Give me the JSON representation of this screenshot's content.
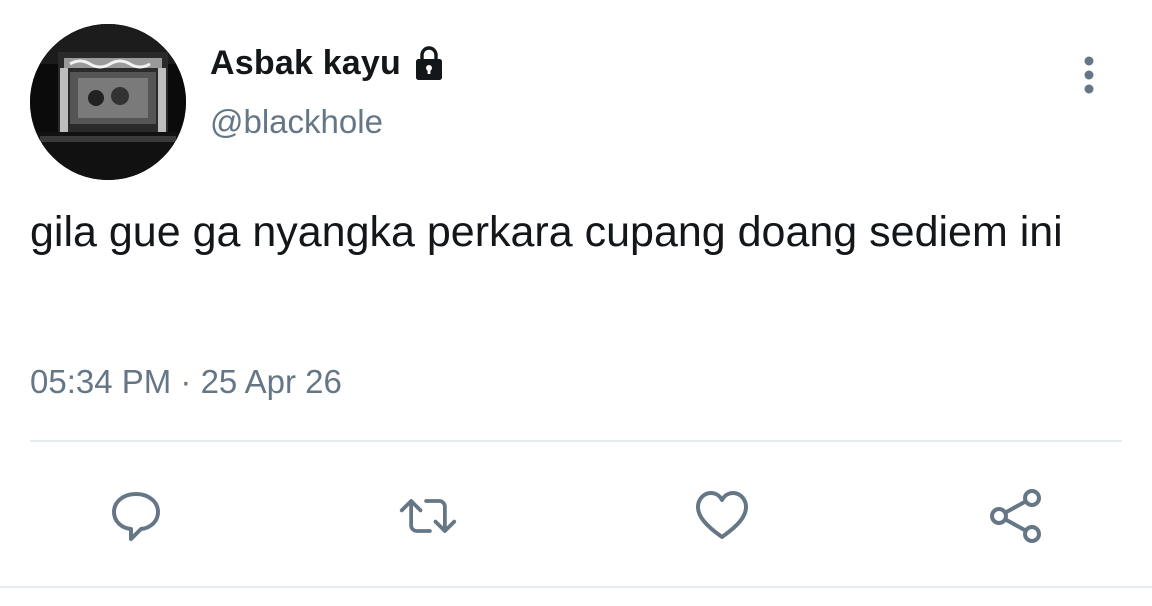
{
  "tweet": {
    "author": {
      "display_name": "Asbak kayu",
      "handle": "@blackhole",
      "protected_icon": "lock-icon",
      "avatar_description_icon": "avatar"
    },
    "text": "gila gue ga nyangka perkara cupang doang sediem ini",
    "timestamp": "05:34 PM · 25 Apr 26"
  },
  "menu": {
    "icon": "more-vertical-icon"
  },
  "actions": [
    {
      "name": "reply",
      "icon": "comment-icon"
    },
    {
      "name": "retweet",
      "icon": "retweet-icon"
    },
    {
      "name": "like",
      "icon": "heart-icon"
    },
    {
      "name": "share",
      "icon": "share-icon"
    }
  ],
  "colors": {
    "text_primary": "#14171a",
    "text_secondary": "#657786",
    "divider": "#e6ecf0"
  }
}
